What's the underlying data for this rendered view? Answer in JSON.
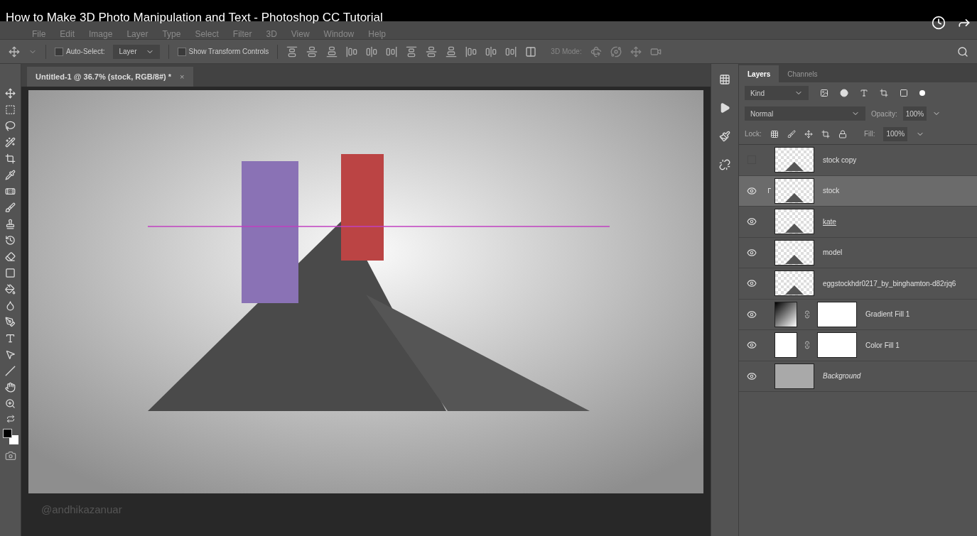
{
  "video": {
    "title": "How to Make 3D Photo Manipulation and Text - Photoshop CC Tutorial",
    "credit": "@andhikazanuar"
  },
  "menu": [
    "File",
    "Edit",
    "Image",
    "Layer",
    "Type",
    "Select",
    "Filter",
    "3D",
    "View",
    "Window",
    "Help"
  ],
  "options_bar": {
    "auto_select": {
      "label": "Auto-Select:",
      "checked": false
    },
    "target": "Layer",
    "transform": {
      "label": "Show Transform Controls",
      "checked": false
    },
    "mode_label": "3D Mode:"
  },
  "document_tab": {
    "title": "Untitled-1 @ 36.7% (stock, RGB/8#) *",
    "close": "×"
  },
  "layers_panel": {
    "tabs": [
      {
        "label": "Layers",
        "selected": true
      },
      {
        "label": "Channels",
        "selected": false
      }
    ],
    "filter": "Kind",
    "blend_mode": "Normal",
    "opacity_label": "Opacity:",
    "opacity": "100%",
    "lock_label": "Lock:",
    "fill_label": "Fill:",
    "fill": "100%",
    "layers": [
      {
        "name": "stock copy",
        "kind": "pixel",
        "visible": false,
        "selected": false,
        "clipped": false,
        "underlined": false,
        "italic": false
      },
      {
        "name": "stock",
        "kind": "pixel",
        "visible": true,
        "selected": true,
        "clipped": true,
        "underlined": false,
        "italic": false
      },
      {
        "name": "kate",
        "kind": "pixel",
        "visible": true,
        "selected": false,
        "clipped": false,
        "underlined": true,
        "italic": false
      },
      {
        "name": "model",
        "kind": "pixel",
        "visible": true,
        "selected": false,
        "clipped": false,
        "underlined": false,
        "italic": false
      },
      {
        "name": "eggstockhdr0217_by_binghamton-d82rjq6",
        "kind": "pixel",
        "visible": true,
        "selected": false,
        "clipped": false,
        "underlined": false,
        "italic": false
      },
      {
        "name": "Gradient Fill 1",
        "kind": "gradient",
        "visible": true,
        "selected": false,
        "clipped": false,
        "underlined": false,
        "italic": false
      },
      {
        "name": "Color Fill 1",
        "kind": "color",
        "visible": true,
        "selected": false,
        "clipped": false,
        "underlined": false,
        "italic": false
      },
      {
        "name": "Background",
        "kind": "background",
        "visible": true,
        "selected": false,
        "clipped": false,
        "underlined": false,
        "italic": true
      }
    ]
  }
}
